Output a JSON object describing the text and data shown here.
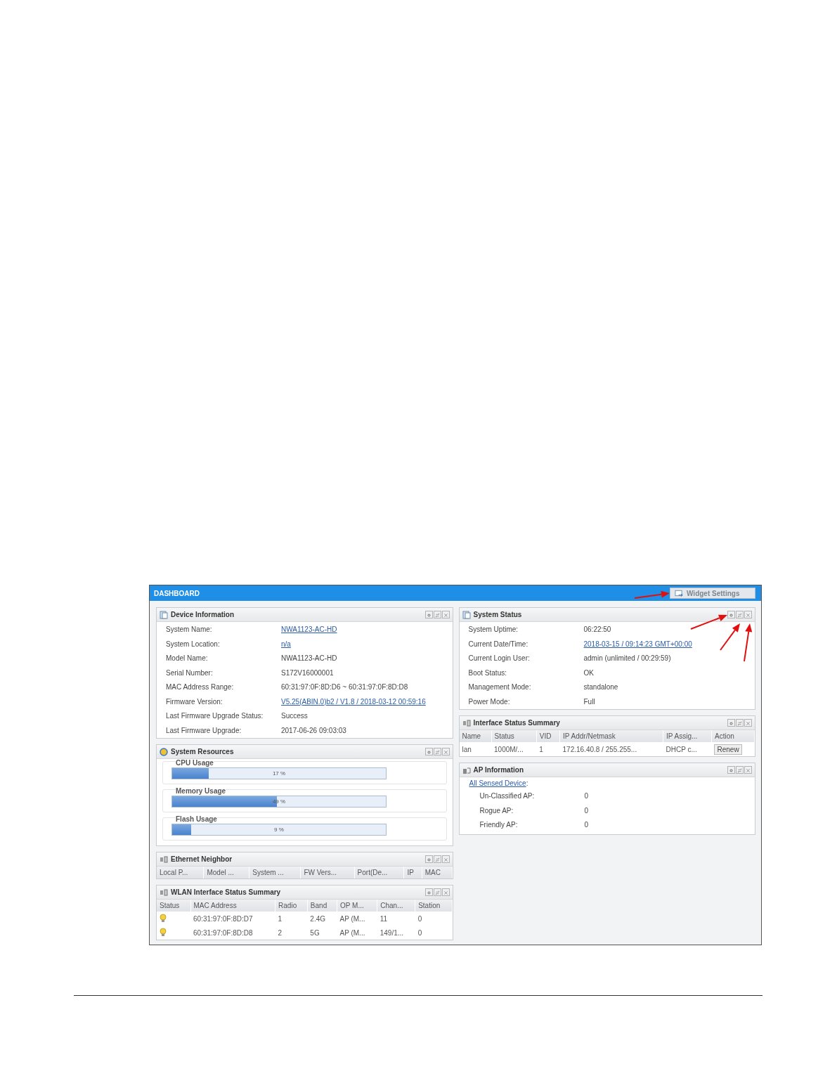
{
  "dashboard": {
    "title": "DASHBOARD",
    "widget_settings": "Widget Settings",
    "columns": [
      [
        {
          "kind": "fields",
          "title": "Device Information",
          "rows": [
            {
              "label": "System Name:",
              "value": "NWA1123-AC-HD",
              "link": true
            },
            {
              "label": "System Location:",
              "value": "n/a",
              "link": true
            },
            {
              "label": "Model Name:",
              "value": "NWA1123-AC-HD",
              "link": false
            },
            {
              "label": "Serial Number:",
              "value": "S172V16000001",
              "link": false
            },
            {
              "label": "MAC Address Range:",
              "value": "60:31:97:0F:8D:D6 ~ 60:31:97:0F:8D:D8",
              "link": false
            },
            {
              "label": "Firmware Version:",
              "value": "V5.25(ABIN.0)b2 / V1.8 / 2018-03-12 00:59:16",
              "link": true
            },
            {
              "label": "Last Firmware Upgrade Status:",
              "value": "Success",
              "link": false
            },
            {
              "label": "Last Firmware Upgrade:",
              "value": "2017-06-26 09:03:03",
              "link": false
            }
          ]
        },
        {
          "kind": "resources",
          "title": "System Resources",
          "bars": [
            {
              "label": "CPU Usage",
              "level": 0.17,
              "reading": "17 %"
            },
            {
              "label": "Memory Usage",
              "level": 0.49,
              "reading": "49 %"
            },
            {
              "label": "Flash Usage",
              "level": 0.09,
              "reading": "9 %"
            }
          ]
        },
        {
          "kind": "table",
          "title": "Ethernet Neighbor",
          "columns": [
            "Local P...",
            "Model ...",
            "System ...",
            "FW Vers...",
            "Port(De...",
            "IP",
            "MAC"
          ]
        },
        {
          "kind": "table",
          "title": "WLAN Interface Status Summary",
          "columns": [
            "Status",
            "MAC Address",
            "Radio",
            "Band",
            "OP M...",
            "Chan...",
            "Station"
          ],
          "rows": [
            {
              "status_on": true,
              "cells": [
                "",
                "60:31:97:0F:8D:D7",
                "1",
                "2.4G",
                "AP (M...",
                "11",
                "0"
              ]
            },
            {
              "status_on": true,
              "cells": [
                "",
                "60:31:97:0F:8D:D8",
                "2",
                "5G",
                "AP (M...",
                "149/1...",
                "0"
              ]
            }
          ]
        }
      ],
      [
        {
          "kind": "fields",
          "title": "System Status",
          "rows": [
            {
              "label": "System Uptime:",
              "value": "06:22:50",
              "link": false
            },
            {
              "label": "Current Date/Time:",
              "value": "2018-03-15 / 09:14:23 GMT+00:00",
              "link": true
            },
            {
              "label": "Current Login User:",
              "value": "admin (unlimited / 00:29:59)",
              "link": false
            },
            {
              "label": "Boot Status:",
              "value": "OK",
              "link": false
            },
            {
              "label": "Management Mode:",
              "value": "standalone",
              "link": false
            },
            {
              "label": "Power Mode:",
              "value": "Full",
              "link": false
            }
          ]
        },
        {
          "kind": "table",
          "title": "Interface Status Summary",
          "columns": [
            "Name",
            "Status",
            "VID",
            "IP Addr/Netmask",
            "IP Assig...",
            "Action"
          ],
          "rows": [
            {
              "cells": [
                "lan",
                "1000M/...",
                "1",
                "172.16.40.8 / 255.255...",
                "DHCP c..."
              ],
              "action": "Renew"
            }
          ]
        },
        {
          "kind": "ap",
          "title": "AP Information",
          "link": "All Sensed Device",
          "link_suffix": ":",
          "rows": [
            {
              "label": "Un-Classified AP:",
              "value": "0"
            },
            {
              "label": "Rogue AP:",
              "value": "0"
            },
            {
              "label": "Friendly AP:",
              "value": "0"
            }
          ]
        }
      ]
    ]
  }
}
